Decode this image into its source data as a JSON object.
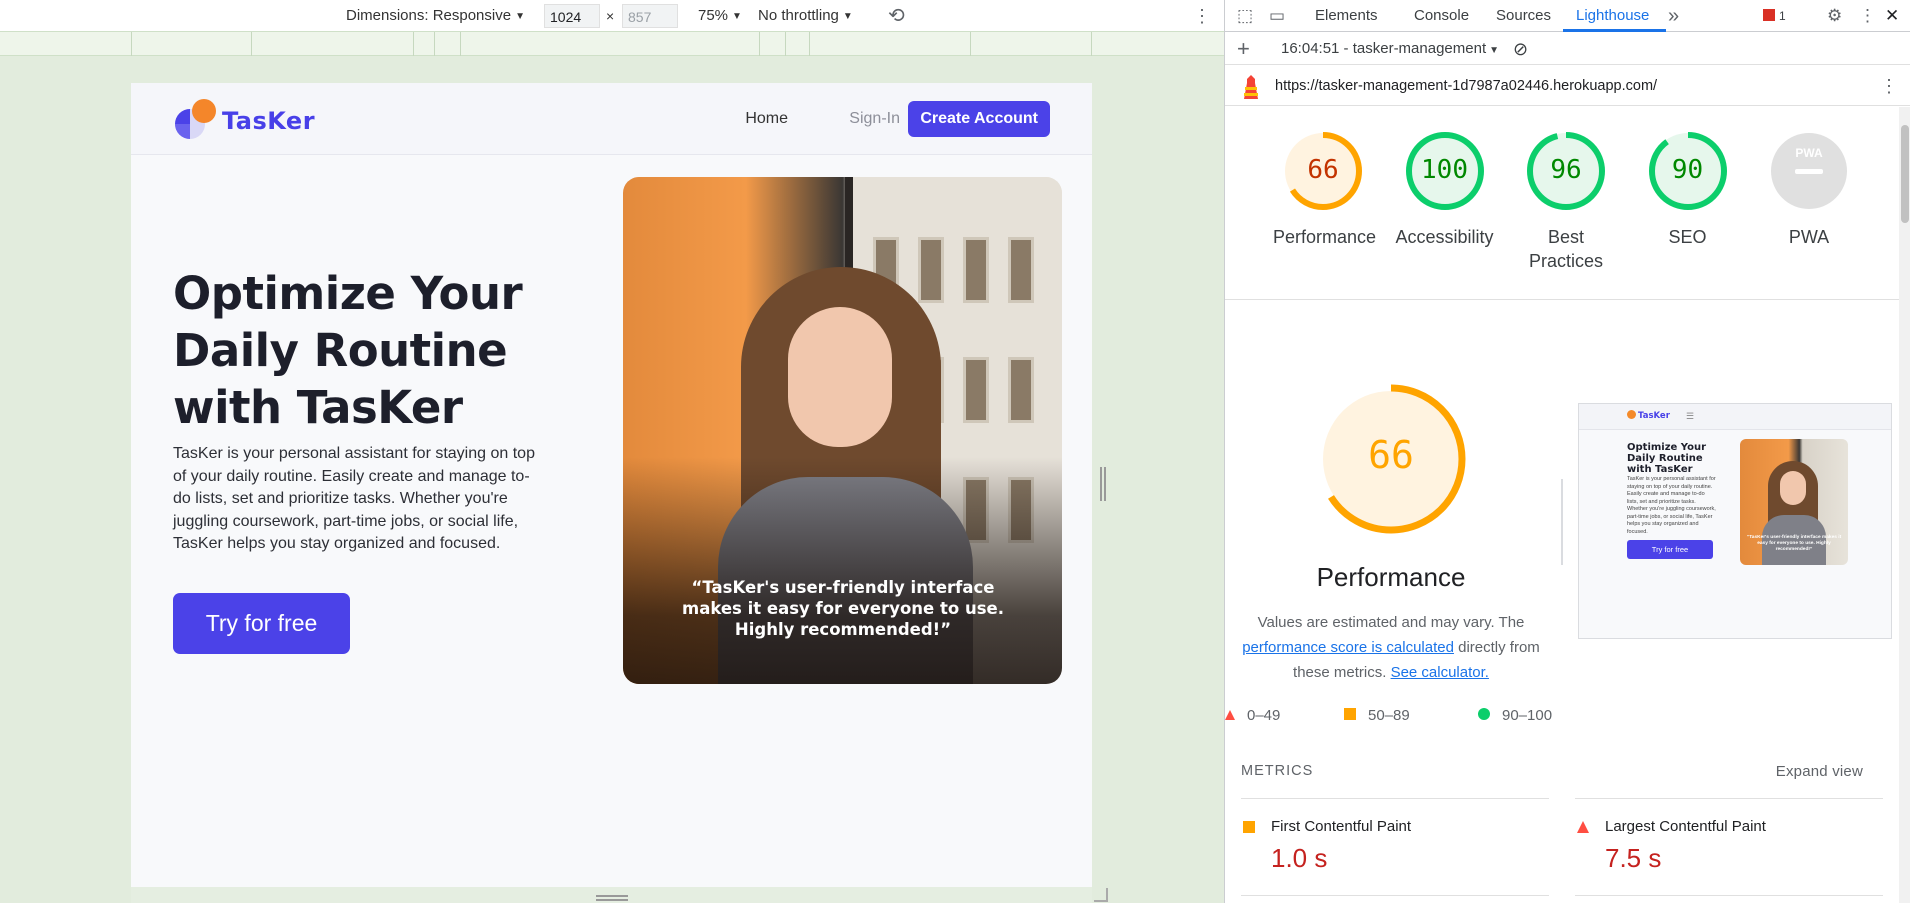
{
  "device_toolbar": {
    "dimensions_label": "Dimensions: Responsive",
    "width_value": "1024",
    "separator": "×",
    "height_value": "857",
    "zoom": "75%",
    "throttling": "No throttling"
  },
  "site": {
    "logo_text": "TasKer",
    "nav": {
      "home": "Home",
      "signin": "Sign-In",
      "create_account": "Create Account"
    },
    "hero": {
      "title": "Optimize Your Daily Routine with TasKer",
      "description": "TasKer is your personal assistant for staying on top of your daily routine. Easily create and manage to-do lists, set and prioritize tasks. Whether you're juggling coursework, part-time jobs, or social life, TasKer helps you stay organized and focused.",
      "cta": "Try for free",
      "quote": "“TasKer's user-friendly interface makes it easy for everyone to use. Highly recommended!”"
    }
  },
  "devtools": {
    "tabs": [
      "Elements",
      "Console",
      "Sources",
      "Lighthouse"
    ],
    "active_tab": "Lighthouse",
    "more_tabs": "»",
    "error_count": "1",
    "report_selector": "16:04:51 - tasker-management",
    "url": "https://tasker-management-1d7987a02446.herokuapp.com/"
  },
  "lighthouse": {
    "scores": [
      {
        "label": "Performance",
        "value": 66,
        "color": "#ffa400",
        "text_color": "#c33300",
        "fill": "#fff3e0"
      },
      {
        "label": "Accessibility",
        "value": 100,
        "color": "#0cce6b",
        "text_color": "#008800",
        "fill": "#e6f7ec"
      },
      {
        "label": "Best Practices",
        "value": 96,
        "color": "#0cce6b",
        "text_color": "#008800",
        "fill": "#e6f7ec"
      },
      {
        "label": "SEO",
        "value": 90,
        "color": "#0cce6b",
        "text_color": "#008800",
        "fill": "#e6f7ec"
      },
      {
        "label": "PWA",
        "value": null,
        "color": "#9e9e9e",
        "text_color": "#9e9e9e",
        "fill": "#e0e0e0"
      }
    ],
    "pwa_badge": "PWA",
    "detail": {
      "score": "66",
      "score_value": 66,
      "title": "Performance",
      "desc_prefix": "Values are estimated and may vary. The ",
      "desc_link": "performance score is calculated",
      "desc_middle": " directly from these metrics. ",
      "desc_link2": "See calculator."
    },
    "legend": [
      "0–49",
      "50–89",
      "90–100"
    ],
    "thumbnail": {
      "logo": "TasKer",
      "title": "Optimize Your Daily Routine with TasKer",
      "desc": "TasKer is your personal assistant for staying on top of your daily routine. Easily create and manage to-do lists, set and prioritize tasks. Whether you're juggling coursework, part-time jobs, or social life, TasKer helps you stay organized and focused.",
      "cta": "Try for free",
      "quote": "“TasKer's user-friendly interface makes it easy for everyone to use. Highly recommended!”"
    },
    "metrics": {
      "heading": "METRICS",
      "expand": "Expand view",
      "items": [
        {
          "label": "First Contentful Paint",
          "value": "1.0 s",
          "status": "average"
        },
        {
          "label": "Largest Contentful Paint",
          "value": "7.5 s",
          "status": "fail"
        }
      ]
    },
    "colors": {
      "accent": "#4b42e8",
      "devtools_active": "#1a73e8",
      "fail": "#ff4e42",
      "average": "#ffa400",
      "pass": "#0cce6b"
    }
  }
}
